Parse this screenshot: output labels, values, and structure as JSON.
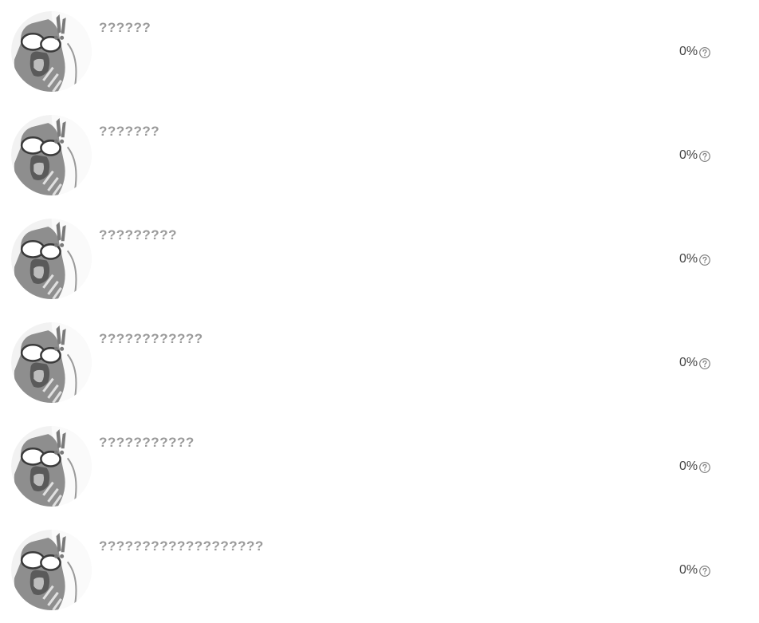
{
  "rows": [
    {
      "name": "??????",
      "percent": "0%",
      "avatar_icon": "default-avatar-icon",
      "help_icon": "question-circle-icon"
    },
    {
      "name": "???????",
      "percent": "0%",
      "avatar_icon": "default-avatar-icon",
      "help_icon": "question-circle-icon"
    },
    {
      "name": "?????????",
      "percent": "0%",
      "avatar_icon": "default-avatar-icon",
      "help_icon": "question-circle-icon"
    },
    {
      "name": "????????????",
      "percent": "0%",
      "avatar_icon": "default-avatar-icon",
      "help_icon": "question-circle-icon"
    },
    {
      "name": "???????????",
      "percent": "0%",
      "avatar_icon": "default-avatar-icon",
      "help_icon": "question-circle-icon"
    },
    {
      "name": "???????????????????",
      "percent": "0%",
      "avatar_icon": "default-avatar-icon",
      "help_icon": "question-circle-icon"
    }
  ],
  "colors": {
    "name_text": "#9a9a9a",
    "percent_text": "#444444",
    "icon_stroke": "#777777",
    "background": "#ffffff"
  }
}
